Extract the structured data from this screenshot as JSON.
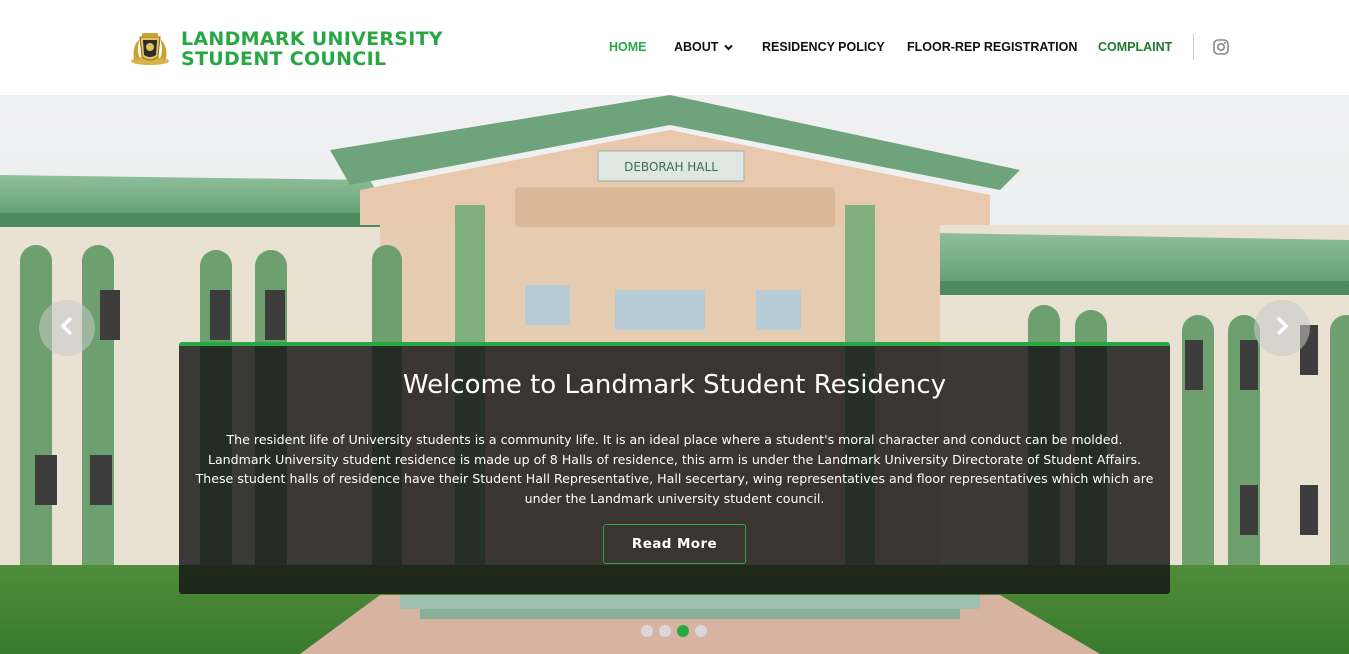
{
  "brand": {
    "line1": "LANDMARK UNIVERSITY",
    "line2": "STUDENT COUNCIL",
    "logo": "crest-logo",
    "color": "#27a844"
  },
  "nav": {
    "home": "HOME",
    "about": "ABOUT",
    "residency_policy": "RESIDENCY POLICY",
    "floor_rep": "FLOOR-REP REGISTRATION",
    "complaint": "COMPLAINT",
    "social_icon": "instagram-icon"
  },
  "hero": {
    "title": "Welcome to Landmark Student Residency",
    "paragraph": [
      "The resident life of University students is a community life. It is an ideal place where a student's moral character and conduct can be molded.",
      "Landmark University student residence is made up of 8 Halls of residence, this arm is under the Landmark University Directorate of Student Affairs.",
      "These student halls of residence have their Student Hall Representative, Hall secertary, wing representatives and floor representatives which which are under the Landmark university student council."
    ],
    "button": "Read More",
    "building_sign": "DEBORAH HALL",
    "slides_total": 4,
    "active_slide": 3
  },
  "colors": {
    "accent": "#27a844",
    "complaint": "#1e7a30"
  }
}
